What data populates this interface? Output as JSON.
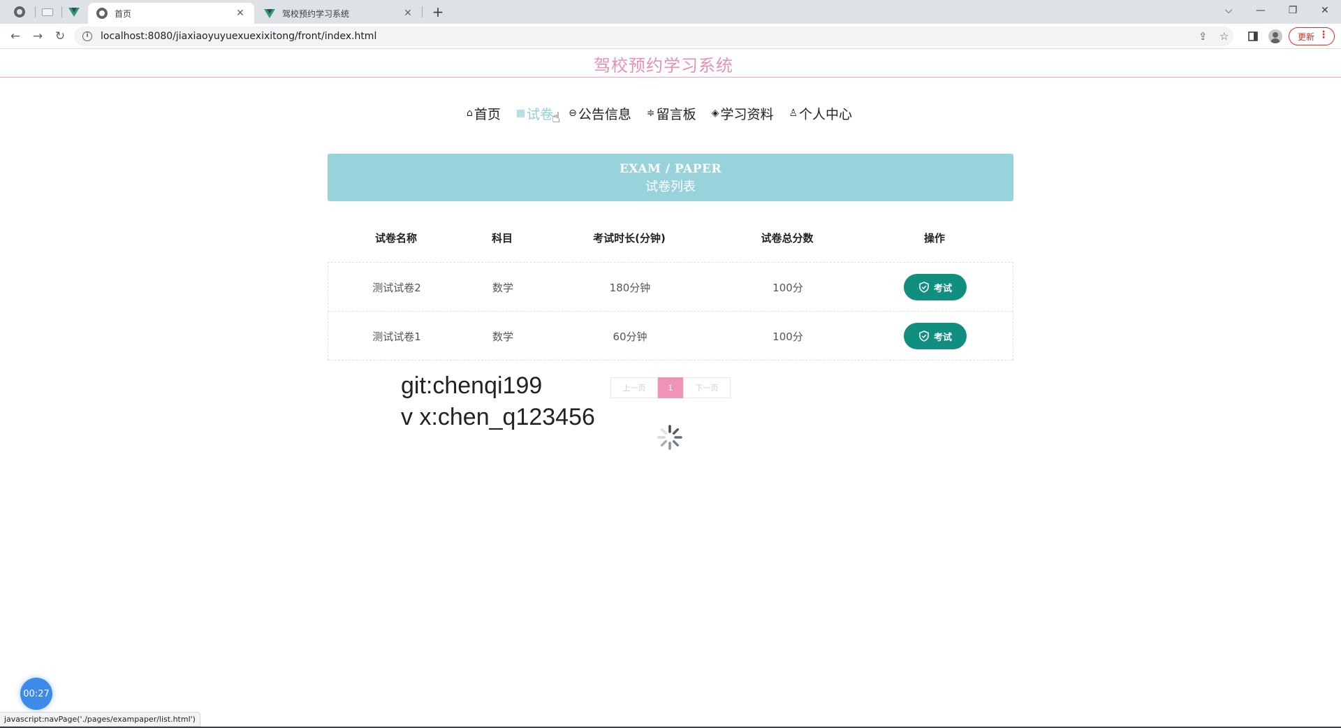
{
  "browser": {
    "tabs": [
      {
        "title": "首页",
        "active": true
      },
      {
        "title": "驾校预约学习系统",
        "active": false
      }
    ],
    "url": "localhost:8080/jiaxiaoyuyuexuexixitong/front/index.html",
    "update_label": "更新",
    "status_text": "javascript:navPage('./pages/exampaper/list.html')"
  },
  "site": {
    "title": "驾校预约学习系统"
  },
  "nav": {
    "items": [
      {
        "label": "首页",
        "icon": "home-icon"
      },
      {
        "label": "试卷",
        "icon": "grid-icon",
        "active": true
      },
      {
        "label": "公告信息",
        "icon": "notice-icon"
      },
      {
        "label": "留言板",
        "icon": "message-icon"
      },
      {
        "label": "学习资料",
        "icon": "graduation-cap-icon"
      },
      {
        "label": "个人中心",
        "icon": "user-icon"
      }
    ]
  },
  "banner": {
    "en": "EXAM / PAPER",
    "cn": "试卷列表"
  },
  "table": {
    "columns": [
      "试卷名称",
      "科目",
      "考试时长(分钟)",
      "试卷总分数",
      "操作"
    ],
    "rows": [
      {
        "name": "测试试卷2",
        "subject": "数学",
        "duration": "180分钟",
        "score": "100分",
        "action": "考试"
      },
      {
        "name": "测试试卷1",
        "subject": "数学",
        "duration": "60分钟",
        "score": "100分",
        "action": "考试"
      }
    ]
  },
  "overlay": {
    "line1": "git:chenqi199",
    "line2": "v x:chen_q123456"
  },
  "pager": {
    "prev": "上一页",
    "current": "1",
    "next": "下一页"
  },
  "timer": "00:27",
  "colors": {
    "accent_pink": "#e890b3",
    "banner_teal": "#98d3dc",
    "button_green": "#108f80",
    "pager_active": "#ef94b7"
  }
}
